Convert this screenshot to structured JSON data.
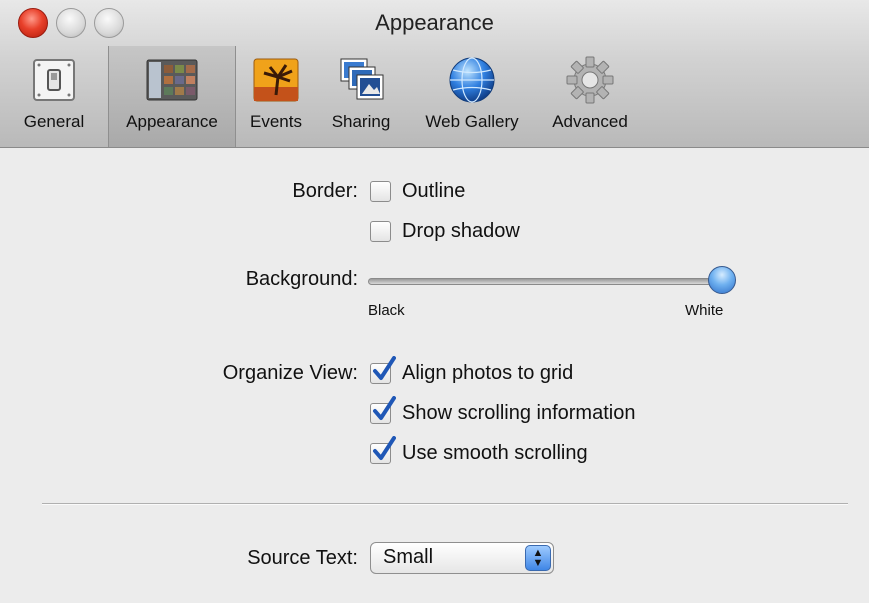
{
  "window": {
    "title": "Appearance"
  },
  "toolbar": {
    "items": [
      {
        "label": "General",
        "icon": "light-switch-icon",
        "selected": false
      },
      {
        "label": "Appearance",
        "icon": "window-thumbnails-icon",
        "selected": true
      },
      {
        "label": "Events",
        "icon": "palm-tree-sunset-icon",
        "selected": false
      },
      {
        "label": "Sharing",
        "icon": "stacked-photos-icon",
        "selected": false
      },
      {
        "label": "Web Gallery",
        "icon": "globe-icon",
        "selected": false
      },
      {
        "label": "Advanced",
        "icon": "gear-icon",
        "selected": false
      }
    ]
  },
  "border": {
    "label": "Border:",
    "outline_label": "Outline",
    "outline_checked": false,
    "dropshadow_label": "Drop shadow",
    "dropshadow_checked": false
  },
  "background": {
    "label": "Background:",
    "min_label": "Black",
    "max_label": "White",
    "value": 1.0
  },
  "organize": {
    "label": "Organize View:",
    "align_label": "Align photos to grid",
    "align_checked": true,
    "scrollinfo_label": "Show scrolling information",
    "scrollinfo_checked": true,
    "smooth_label": "Use smooth scrolling",
    "smooth_checked": true
  },
  "source_text": {
    "label": "Source Text:",
    "value": "Small"
  },
  "colors": {
    "accent": "#3f86e6",
    "close_button": "#e8402a"
  }
}
